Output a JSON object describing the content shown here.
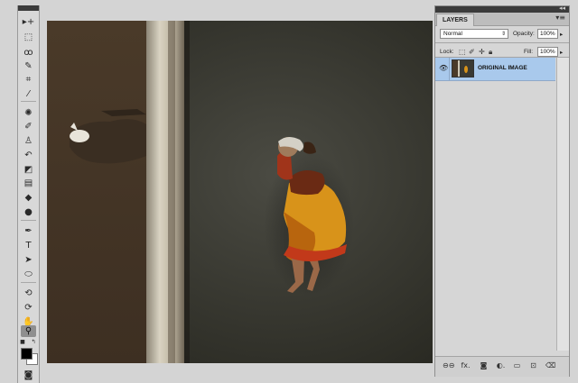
{
  "tools_panel": {
    "tools": [
      {
        "name": "move-tool-icon",
        "glyph": "▸+"
      },
      {
        "name": "marquee-tool-icon",
        "glyph": "⬚"
      },
      {
        "name": "lasso-tool-icon",
        "glyph": "ꝏ"
      },
      {
        "name": "quick-selection-tool-icon",
        "glyph": "✎"
      },
      {
        "name": "crop-tool-icon",
        "glyph": "⌗"
      },
      {
        "name": "eyedropper-tool-icon",
        "glyph": "⁄"
      },
      {
        "name": "spot-healing-tool-icon",
        "glyph": "✺"
      },
      {
        "name": "brush-tool-icon",
        "glyph": "✐"
      },
      {
        "name": "clone-stamp-tool-icon",
        "glyph": "♙"
      },
      {
        "name": "history-brush-tool-icon",
        "glyph": "↶"
      },
      {
        "name": "eraser-tool-icon",
        "glyph": "◩"
      },
      {
        "name": "gradient-tool-icon",
        "glyph": "▤"
      },
      {
        "name": "blur-tool-icon",
        "glyph": "◆"
      },
      {
        "name": "dodge-tool-icon",
        "glyph": "●"
      },
      {
        "name": "pen-tool-icon",
        "glyph": "✒"
      },
      {
        "name": "type-tool-icon",
        "glyph": "T"
      },
      {
        "name": "path-selection-tool-icon",
        "glyph": "➤"
      },
      {
        "name": "shape-tool-icon",
        "glyph": "⬭"
      },
      {
        "name": "3d-rotate-tool-icon",
        "glyph": "⟲"
      },
      {
        "name": "3d-orbit-tool-icon",
        "glyph": "⟳"
      },
      {
        "name": "hand-tool-icon",
        "glyph": "✋"
      },
      {
        "name": "zoom-tool-icon",
        "glyph": "⚲"
      }
    ],
    "active_tool": "zoom-tool-icon",
    "foreground_color": "#000000",
    "background_color": "#ffffff"
  },
  "layers_panel": {
    "tab_label": "LAYERS",
    "blend_mode": "Normal",
    "opacity_label": "Opacity:",
    "opacity_value": "100%",
    "lock_label": "Lock:",
    "fill_label": "Fill:",
    "fill_value": "100%",
    "layers": [
      {
        "name": "ORIGINAL IMAGE",
        "visible": true,
        "selected": true
      }
    ],
    "bottom_icons": [
      "link-layers-icon",
      "fx-icon",
      "add-mask-icon",
      "adjustment-layer-icon",
      "new-group-icon",
      "new-layer-icon",
      "delete-layer-icon"
    ],
    "bottom_glyphs": [
      "⊖⊖",
      "fx.",
      "◙",
      "◐.",
      "▭",
      "⊡",
      "⌫"
    ],
    "selection_color": "#a9c9ec"
  }
}
